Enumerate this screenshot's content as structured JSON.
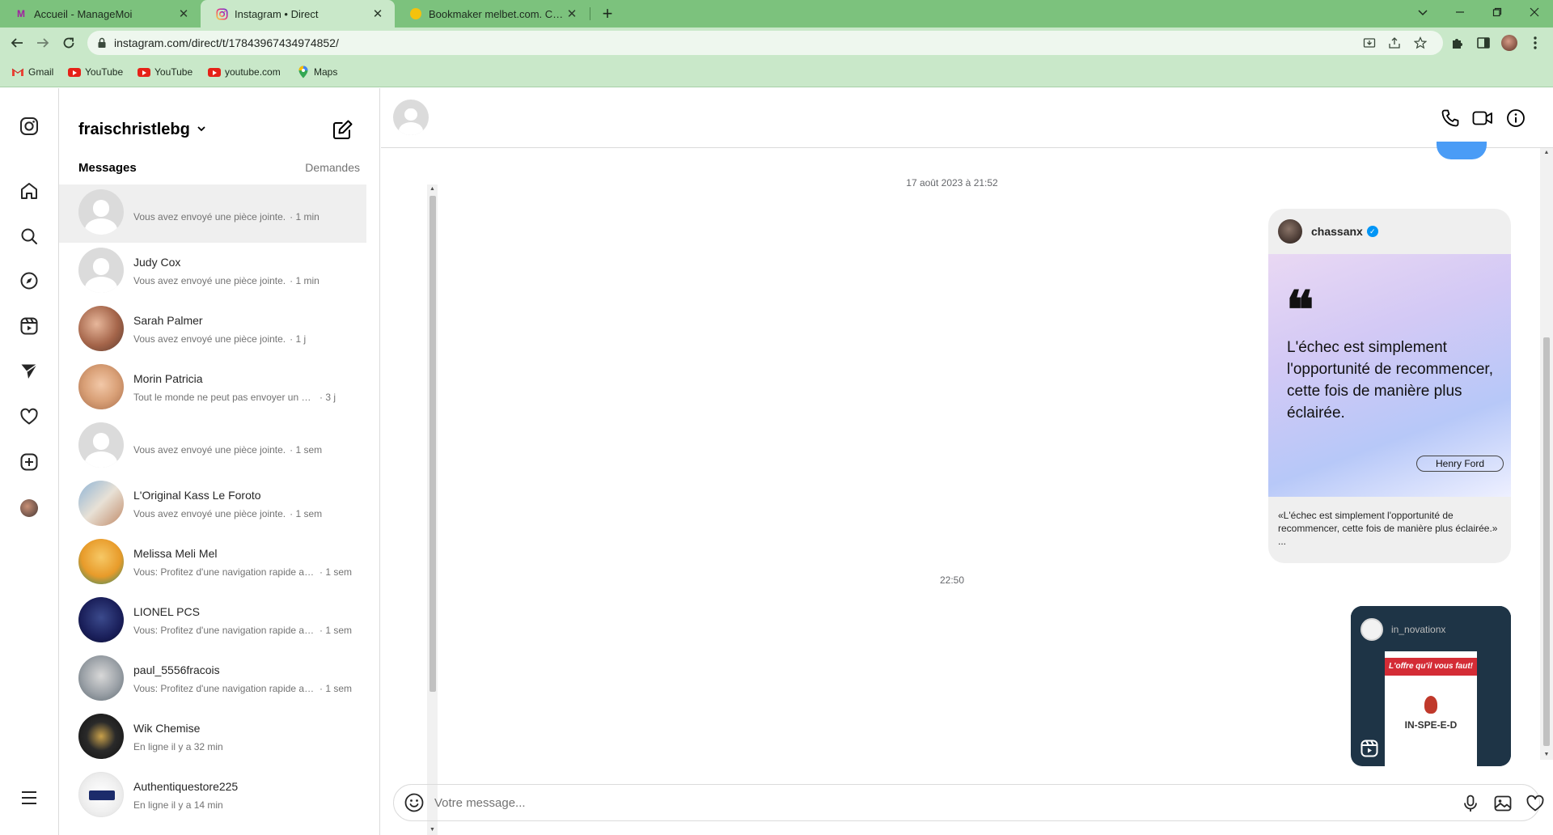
{
  "browser": {
    "tabs": [
      {
        "title": "Accueil - ManageMoi",
        "favicon": "M"
      },
      {
        "title": "Instagram • Direct",
        "favicon": "instagram-icon"
      },
      {
        "title": "Bookmaker melbet.com. Cotes é",
        "favicon": "melbet-icon"
      }
    ],
    "url": "instagram.com/direct/t/17843967434974852/",
    "bookmarks": [
      {
        "label": "Gmail"
      },
      {
        "label": "YouTube"
      },
      {
        "label": "YouTube"
      },
      {
        "label": "youtube.com"
      },
      {
        "label": "Maps"
      }
    ]
  },
  "inbox": {
    "username": "fraischristlebg",
    "tab_messages": "Messages",
    "tab_requests": "Demandes",
    "conversations": [
      {
        "name": "",
        "preview": "Vous avez envoyé une pièce jointe.",
        "time": "· 1 min",
        "avatar": "default"
      },
      {
        "name": "Judy Cox",
        "preview": "Vous avez envoyé une pièce jointe.",
        "time": "· 1 min",
        "avatar": "default"
      },
      {
        "name": "Sarah Palmer",
        "preview": "Vous avez envoyé une pièce jointe.",
        "time": "· 1 j",
        "avatar": "photo"
      },
      {
        "name": "Morin Patricia",
        "preview": "Tout le monde ne peut pas envoyer un mess...",
        "time": "· 3 j",
        "avatar": "photo"
      },
      {
        "name": "",
        "preview": "Vous avez envoyé une pièce jointe.",
        "time": "· 1 sem",
        "avatar": "default"
      },
      {
        "name": "L'Original Kass Le Foroto",
        "preview": "Vous avez envoyé une pièce jointe.",
        "time": "· 1 sem",
        "avatar": "photo"
      },
      {
        "name": "Melissa Meli Mel",
        "preview": "Vous: Profitez d'une navigation rapide av...",
        "time": "· 1 sem",
        "avatar": "photo"
      },
      {
        "name": "LIONEL PCS",
        "preview": "Vous: Profitez d'une navigation rapide av...",
        "time": "· 1 sem",
        "avatar": "photo"
      },
      {
        "name": "paul_5556fracois",
        "preview": "Vous: Profitez d'une navigation rapide av...",
        "time": "· 1 sem",
        "avatar": "photo"
      },
      {
        "name": "Wik Chemise",
        "preview": "En ligne il y a 32 min",
        "time": "",
        "avatar": "photo"
      },
      {
        "name": "Authentiquestore225",
        "preview": "En ligne il y a 14 min",
        "time": "",
        "avatar": "photo"
      }
    ]
  },
  "chat": {
    "timestamp_1": "17 août 2023 à 21:52",
    "timestamp_2": "22:50",
    "shared_post": {
      "username": "chassanx",
      "quote_mark": "❝",
      "quote": "L'échec est simplement l'opportunité de recommencer, cette fois de manière plus éclairée.",
      "author": "Henry Ford",
      "caption": "«L'échec est simplement l'opportunité de recommencer, cette fois de manière plus éclairée.»",
      "caption_more": "..."
    },
    "reel": {
      "account": "in_novationx",
      "banner": "L'offre qu'il vous faut!",
      "brand": "IN-SPE-E-D"
    },
    "composer_placeholder": "Votre message..."
  },
  "colors": {
    "tabbar": "#7cc27d",
    "toolbar": "#c9e8c9",
    "bubble_blue": "#4a9cf6",
    "verified": "#0095f6"
  }
}
